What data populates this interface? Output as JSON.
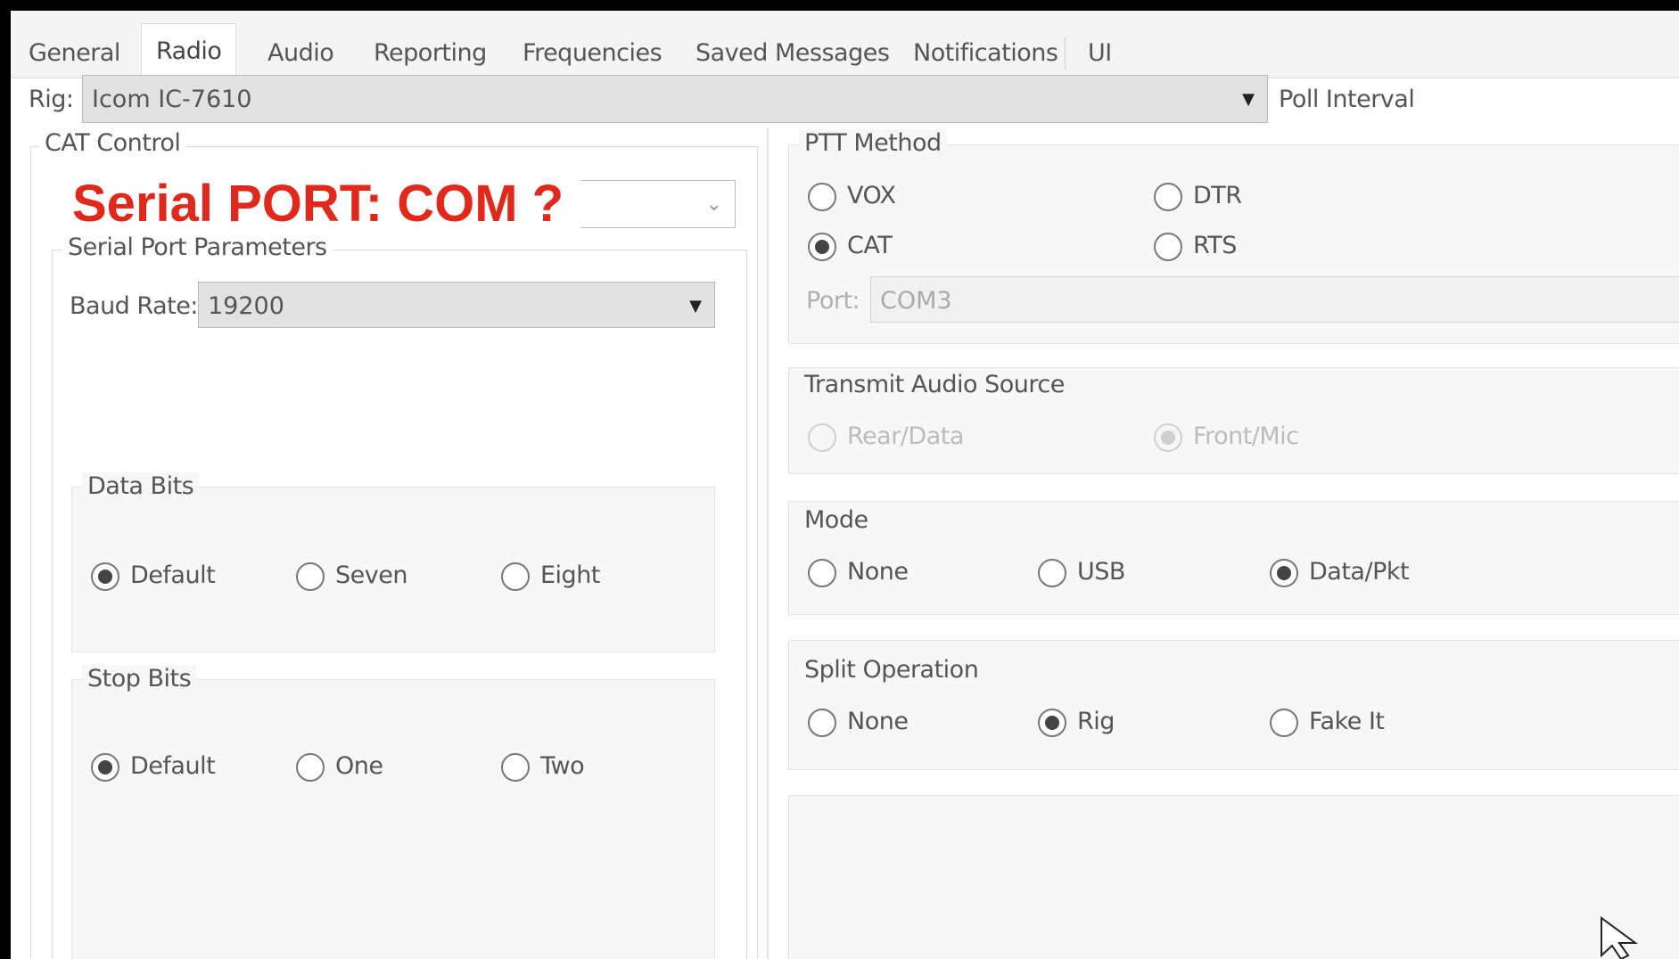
{
  "tabs": [
    "General",
    "Radio",
    "Audio",
    "Reporting",
    "Frequencies",
    "Saved Messages",
    "Notifications",
    "UI"
  ],
  "rig": {
    "label": "Rig:",
    "value": "Icom IC-7610",
    "poll_label": "Poll Interval"
  },
  "cat_control": {
    "title": "CAT Control",
    "overlay_annotation": "Serial PORT: COM ?",
    "serial_params_title": "Serial Port Parameters",
    "baud_label": "Baud Rate:",
    "baud_value": "19200",
    "data_bits": {
      "title": "Data Bits",
      "options": [
        "Default",
        "Seven",
        "Eight"
      ],
      "selected": "Default"
    },
    "stop_bits": {
      "title": "Stop Bits",
      "options": [
        "Default",
        "One",
        "Two"
      ],
      "selected": "Default"
    }
  },
  "ptt": {
    "title": "PTT Method",
    "options": [
      "VOX",
      "DTR",
      "CAT",
      "RTS"
    ],
    "selected": "CAT",
    "port_label": "Port:",
    "port_value": "COM3"
  },
  "tx_audio": {
    "title": "Transmit Audio Source",
    "options": [
      "Rear/Data",
      "Front/Mic"
    ],
    "selected": "Front/Mic"
  },
  "mode": {
    "title": "Mode",
    "options": [
      "None",
      "USB",
      "Data/Pkt"
    ],
    "selected": "Data/Pkt"
  },
  "split": {
    "title": "Split Operation",
    "options": [
      "None",
      "Rig",
      "Fake It"
    ],
    "selected": "Rig"
  },
  "icons": {
    "dropdown": "chevron-down-icon",
    "cursor": "mouse-pointer-icon"
  },
  "colors": {
    "annotation": "#e0281b",
    "window_bg": "#ffffff",
    "frame": "#000000"
  }
}
